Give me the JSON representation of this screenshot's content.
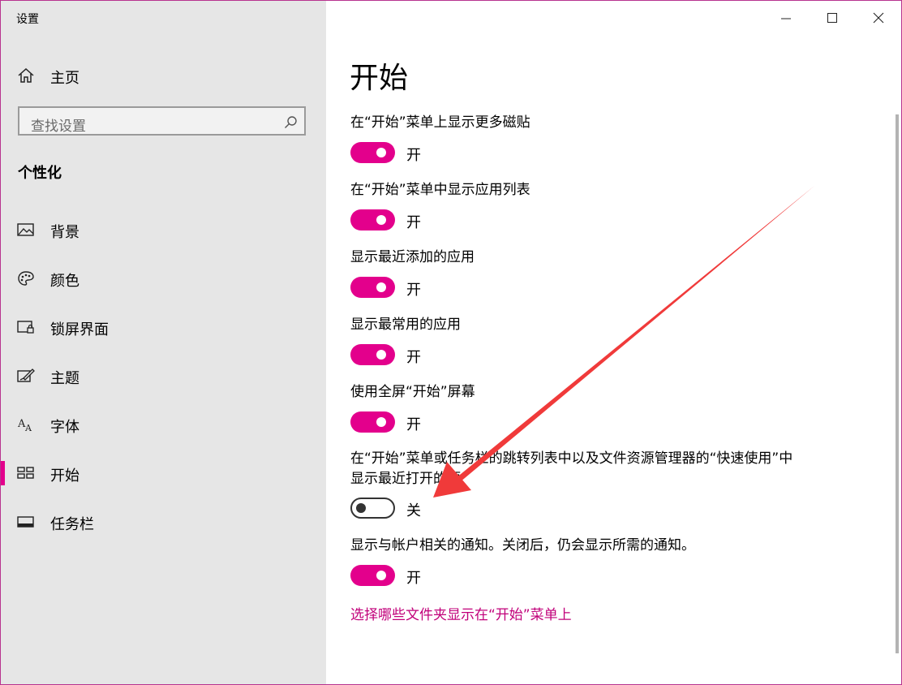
{
  "window": {
    "title": "设置"
  },
  "sidebar": {
    "home_label": "主页",
    "search_placeholder": "查找设置",
    "section_title": "个性化",
    "items": [
      {
        "label": "背景",
        "icon": "picture-icon"
      },
      {
        "label": "颜色",
        "icon": "palette-icon"
      },
      {
        "label": "锁屏界面",
        "icon": "lock-screen-icon"
      },
      {
        "label": "主题",
        "icon": "theme-brush-icon"
      },
      {
        "label": "字体",
        "icon": "font-icon"
      },
      {
        "label": "开始",
        "icon": "start-grid-icon",
        "active": true
      },
      {
        "label": "任务栏",
        "icon": "taskbar-icon"
      }
    ]
  },
  "main": {
    "title": "开始",
    "settings": [
      {
        "label": "在“开始”菜单上显示更多磁贴",
        "on": true,
        "state": "开"
      },
      {
        "label": "在“开始”菜单中显示应用列表",
        "on": true,
        "state": "开"
      },
      {
        "label": "显示最近添加的应用",
        "on": true,
        "state": "开"
      },
      {
        "label": "显示最常用的应用",
        "on": true,
        "state": "开"
      },
      {
        "label": "使用全屏“开始”屏幕",
        "on": true,
        "state": "开"
      },
      {
        "label": "在“开始”菜单或任务栏的跳转列表中以及文件资源管理器的“快速使用”中显示最近打开的项",
        "on": false,
        "state": "关"
      },
      {
        "label": "显示与帐户相关的通知。关闭后，仍会显示所需的通知。",
        "on": true,
        "state": "开"
      }
    ],
    "link": "选择哪些文件夹显示在“开始”菜单上"
  },
  "colors": {
    "accent": "#e3008c",
    "link": "#c1007a",
    "annotation_arrow": "#f03a3a"
  }
}
